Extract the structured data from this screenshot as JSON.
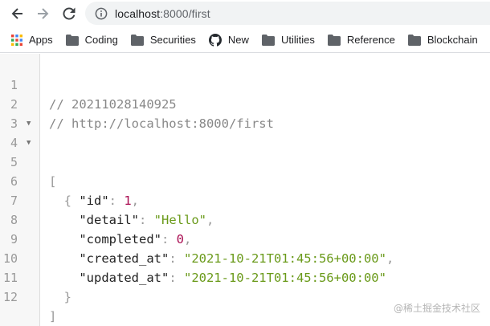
{
  "browser": {
    "url_host": "localhost",
    "url_rest": ":8000/first",
    "colors": {
      "toolbar_bg": "#ffffff",
      "omnibox_bg": "#f1f3f4",
      "accent": "#1a73e8"
    },
    "icons": {
      "back": "arrow-left-icon",
      "forward": "arrow-right-icon",
      "reload": "reload-icon",
      "info": "info-icon"
    }
  },
  "bookmarks": [
    {
      "label": "Apps",
      "icon": "apps-grid-icon"
    },
    {
      "label": "Coding",
      "icon": "folder-icon"
    },
    {
      "label": "Securities",
      "icon": "folder-icon"
    },
    {
      "label": "New",
      "icon": "github-icon"
    },
    {
      "label": "Utilities",
      "icon": "folder-icon"
    },
    {
      "label": "Reference",
      "icon": "folder-icon"
    },
    {
      "label": "Blockchain",
      "icon": "folder-icon"
    }
  ],
  "code": {
    "lines": [
      {
        "n": "1",
        "comment": "// 20211028140925"
      },
      {
        "n": "2",
        "comment": "// http://localhost:8000/first"
      },
      {
        "n": "3"
      },
      {
        "n": "4",
        "open": "["
      },
      {
        "n": "5",
        "open": "  {"
      },
      {
        "n": "6",
        "key": "\"id\"",
        "value": "1",
        "kind": "num",
        "comma": ","
      },
      {
        "n": "7",
        "key": "\"detail\"",
        "value": "\"Hello\"",
        "kind": "str",
        "comma": ","
      },
      {
        "n": "8",
        "key": "\"completed\"",
        "value": "0",
        "kind": "num",
        "comma": ","
      },
      {
        "n": "9",
        "key": "\"created_at\"",
        "value": "\"2021-10-21T01:45:56+00:00\"",
        "kind": "str",
        "comma": ","
      },
      {
        "n": "10",
        "key": "\"updated_at\"",
        "value": "\"2021-10-21T01:45:56+00:00\"",
        "kind": "str",
        "comma": ""
      },
      {
        "n": "11",
        "close": "  }"
      },
      {
        "n": "12",
        "close": "]"
      }
    ]
  },
  "watermark": "@稀土掘金技术社区"
}
